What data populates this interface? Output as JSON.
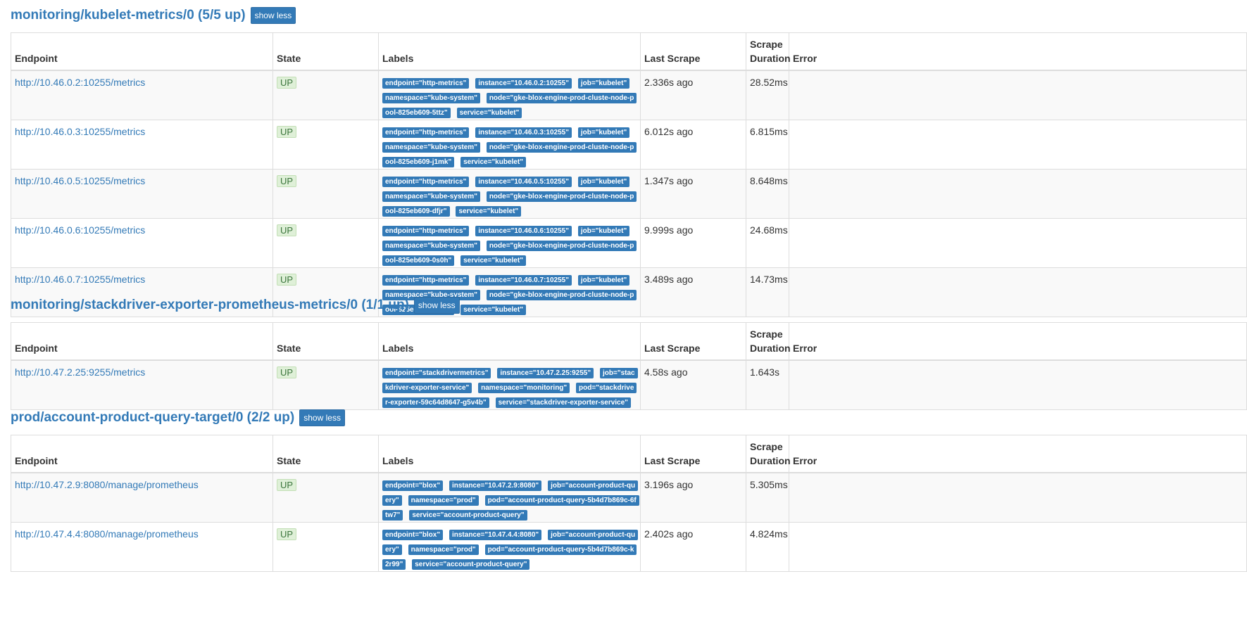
{
  "sections": [
    {
      "title": "monitoring/kubelet-metrics/0 (5/5 up)",
      "button": "show less",
      "headers": {
        "endpoint": "Endpoint",
        "state": "State",
        "labels": "Labels",
        "last": "Last Scrape",
        "duration": "Scrape Duration",
        "error": "Error"
      },
      "rows": [
        {
          "endpoint": "http://10.46.0.2:10255/metrics",
          "state": "UP",
          "labels": [
            "endpoint=\"http-metrics\"",
            "instance=\"10.46.0.2:10255\"",
            "job=\"kubelet\"",
            "namespace=\"kube-system\"",
            "node=\"gke-blox-engine-prod-cluste-node-pool-825eb609-5ttz\"",
            "service=\"kubelet\""
          ],
          "last": "2.336s ago",
          "duration": "28.52ms",
          "error": ""
        },
        {
          "endpoint": "http://10.46.0.3:10255/metrics",
          "state": "UP",
          "labels": [
            "endpoint=\"http-metrics\"",
            "instance=\"10.46.0.3:10255\"",
            "job=\"kubelet\"",
            "namespace=\"kube-system\"",
            "node=\"gke-blox-engine-prod-cluste-node-pool-825eb609-j1mk\"",
            "service=\"kubelet\""
          ],
          "last": "6.012s ago",
          "duration": "6.815ms",
          "error": ""
        },
        {
          "endpoint": "http://10.46.0.5:10255/metrics",
          "state": "UP",
          "labels": [
            "endpoint=\"http-metrics\"",
            "instance=\"10.46.0.5:10255\"",
            "job=\"kubelet\"",
            "namespace=\"kube-system\"",
            "node=\"gke-blox-engine-prod-cluste-node-pool-825eb609-dfjr\"",
            "service=\"kubelet\""
          ],
          "last": "1.347s ago",
          "duration": "8.648ms",
          "error": ""
        },
        {
          "endpoint": "http://10.46.0.6:10255/metrics",
          "state": "UP",
          "labels": [
            "endpoint=\"http-metrics\"",
            "instance=\"10.46.0.6:10255\"",
            "job=\"kubelet\"",
            "namespace=\"kube-system\"",
            "node=\"gke-blox-engine-prod-cluste-node-pool-825eb609-0s0h\"",
            "service=\"kubelet\""
          ],
          "last": "9.999s ago",
          "duration": "24.68ms",
          "error": ""
        },
        {
          "endpoint": "http://10.46.0.7:10255/metrics",
          "state": "UP",
          "labels": [
            "endpoint=\"http-metrics\"",
            "instance=\"10.46.0.7:10255\"",
            "job=\"kubelet\"",
            "namespace=\"kube-system\"",
            "node=\"gke-blox-engine-prod-cluste-node-pool-825eb609-3g23\"",
            "service=\"kubelet\""
          ],
          "last": "3.489s ago",
          "duration": "14.73ms",
          "error": ""
        }
      ]
    },
    {
      "title": "monitoring/stackdriver-exporter-prometheus-metrics/0 (1/1 up)",
      "button": "show less",
      "headers": {
        "endpoint": "Endpoint",
        "state": "State",
        "labels": "Labels",
        "last": "Last Scrape",
        "duration": "Scrape Duration",
        "error": "Error"
      },
      "rows": [
        {
          "endpoint": "http://10.47.2.25:9255/metrics",
          "state": "UP",
          "labels": [
            "endpoint=\"stackdrivermetrics\"",
            "instance=\"10.47.2.25:9255\"",
            "job=\"stackdriver-exporter-service\"",
            "namespace=\"monitoring\"",
            "pod=\"stackdriver-exporter-59c64d8647-g5v4b\"",
            "service=\"stackdriver-exporter-service\""
          ],
          "last": "4.58s ago",
          "duration": "1.643s",
          "error": ""
        }
      ]
    },
    {
      "title": "prod/account-product-query-target/0 (2/2 up)",
      "button": "show less",
      "headers": {
        "endpoint": "Endpoint",
        "state": "State",
        "labels": "Labels",
        "last": "Last Scrape",
        "duration": "Scrape Duration",
        "error": "Error"
      },
      "rows": [
        {
          "endpoint": "http://10.47.2.9:8080/manage/prometheus",
          "state": "UP",
          "labels": [
            "endpoint=\"blox\"",
            "instance=\"10.47.2.9:8080\"",
            "job=\"account-product-query\"",
            "namespace=\"prod\"",
            "pod=\"account-product-query-5b4d7b869c-6ftw7\"",
            "service=\"account-product-query\""
          ],
          "last": "3.196s ago",
          "duration": "5.305ms",
          "error": ""
        },
        {
          "endpoint": "http://10.47.4.4:8080/manage/prometheus",
          "state": "UP",
          "labels": [
            "endpoint=\"blox\"",
            "instance=\"10.47.4.4:8080\"",
            "job=\"account-product-query\"",
            "namespace=\"prod\"",
            "pod=\"account-product-query-5b4d7b869c-k2r99\"",
            "service=\"account-product-query\""
          ],
          "last": "2.402s ago",
          "duration": "4.824ms",
          "error": ""
        }
      ]
    }
  ]
}
